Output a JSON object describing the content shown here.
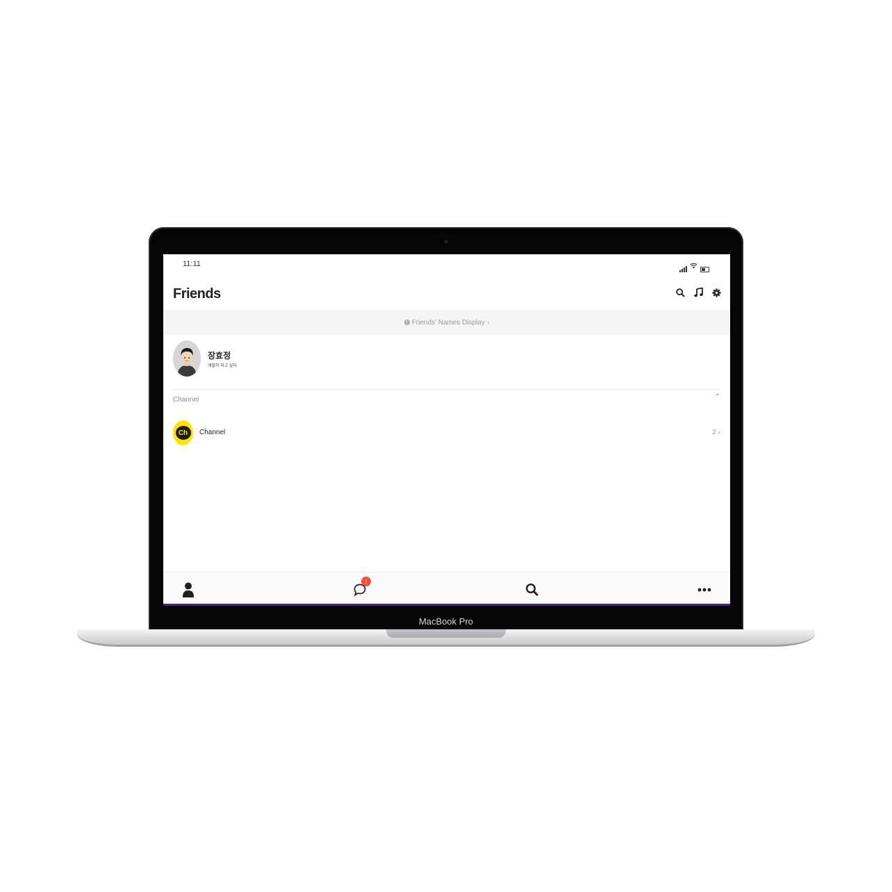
{
  "device": {
    "label": "MacBook Pro"
  },
  "status_bar": {
    "time": "11:11"
  },
  "header": {
    "title": "Friends",
    "icons": [
      "search-icon",
      "music-icon",
      "gear-icon"
    ]
  },
  "notice": {
    "text": "Friends' Names Display",
    "chevron": "›"
  },
  "profile": {
    "name": "장효정",
    "status_message": "개발자 되고 싶다"
  },
  "section": {
    "label": "Channel",
    "toggle": "⌃"
  },
  "channel": {
    "logo_text": "Ch",
    "name": "Channel",
    "count": "2",
    "chevron": "›"
  },
  "tab_bar": {
    "items": [
      "friends-tab",
      "chats-tab",
      "search-tab",
      "more-tab"
    ],
    "chat_badge": "!"
  },
  "colors": {
    "channel_yellow": "#ffe400",
    "badge_red": "#f2523a",
    "accent": "#4b1d9a"
  }
}
